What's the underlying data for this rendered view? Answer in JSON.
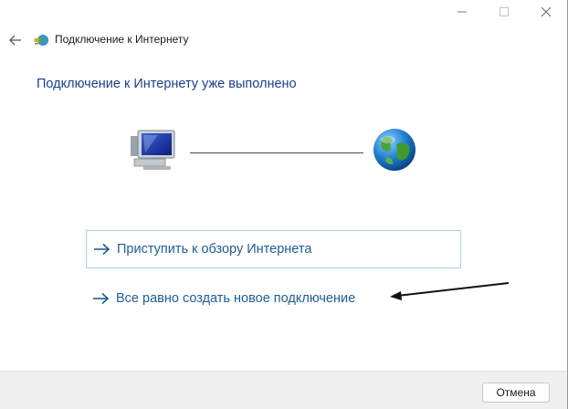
{
  "window": {
    "title": "Подключение к Интернету"
  },
  "main": {
    "heading": "Подключение к Интернету уже выполнено",
    "links": [
      {
        "label": "Приступить к обзору Интернета"
      },
      {
        "label": "Все равно создать новое подключение"
      }
    ]
  },
  "footer": {
    "cancel_label": "Отмена"
  },
  "icons": {
    "back": "back-arrow-icon",
    "title": "network-globe-icon",
    "computer": "computer-icon",
    "globe": "globe-icon",
    "link_arrow": "arrow-right-icon",
    "minimize": "minimize-icon",
    "maximize": "maximize-icon",
    "close": "close-icon"
  },
  "colors": {
    "heading": "#1c3f8c",
    "link": "#1f5d92",
    "link_border": "#a9d0ea",
    "footer_bg": "#f0f0f0"
  }
}
